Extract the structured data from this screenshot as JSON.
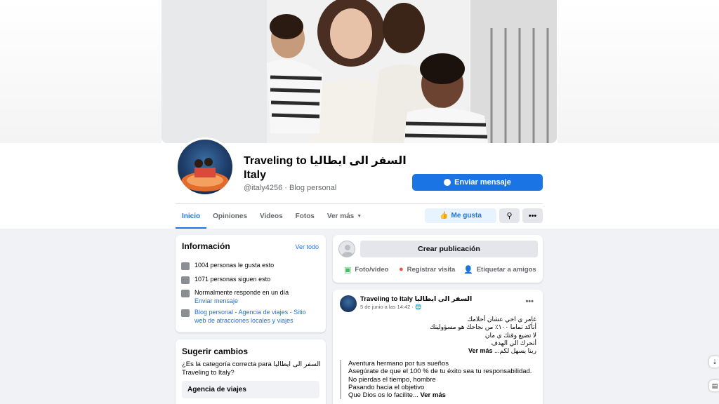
{
  "page": {
    "name": "Traveling to السفر الى ايطاليا Italy",
    "handle": "@italy4256",
    "category": "Blog personal",
    "message_button": "Enviar mensaje"
  },
  "tabs": [
    "Inicio",
    "Opiniones",
    "Videos",
    "Fotos",
    "Ver más"
  ],
  "actions": {
    "like": "Me gusta",
    "search_icon": "search-icon",
    "more_icon": "ellipsis-icon"
  },
  "info": {
    "title": "Información",
    "see_all": "Ver todo",
    "likes": "1004 personas le gusta esto",
    "followers": "1071 personas siguen esto",
    "response": "Normalmente responde en un día",
    "send_message": "Enviar mensaje",
    "categories": "Blog personal - Agencia de viajes - Sitio web de atracciones locales y viajes"
  },
  "suggest": {
    "title": "Sugerir cambios",
    "question": "¿Es la categoría correcta para السفر الى ايطاليا Traveling to Italy?",
    "option": "Agencia de viajes"
  },
  "composer": {
    "create": "Crear publicación",
    "photo": "Foto/video",
    "checkin": "Registrar visita",
    "tag": "Etiquetar a amigos"
  },
  "post": {
    "author": "Traveling to Italy السفر الى ايطاليا",
    "time": "5 de junio a las 14:42 · ",
    "arabic_lines": [
      "غامر ي اخي عشان  أحلامك",
      "أتأكد تماما ١٠٠٪  من نجاحك هو مسؤوليتك",
      "لا تضيع وقتك ي مان",
      "أتحرك الي  الهدف",
      "ربنا يسهل لكم..."
    ],
    "see_more": "Ver más",
    "quote_lines": [
      "Aventura hermano por tus sueños",
      "Asegúrate de que el 100 % de tu éxito sea tu responsabilidad.",
      "No pierdas el tiempo, hombre",
      "Pasando hacia el objetivo",
      "Que Dios os lo facilite..."
    ]
  },
  "colors": {
    "primary": "#1b74e4",
    "background": "#f0f2f5",
    "secondary_text": "#65676b"
  }
}
